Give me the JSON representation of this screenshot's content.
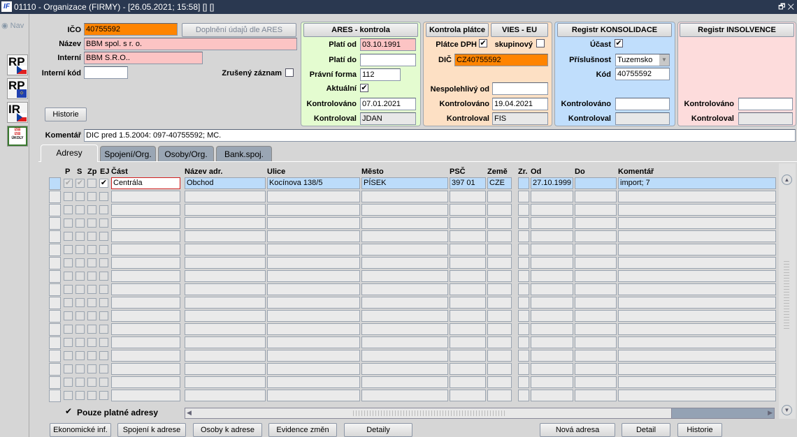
{
  "window": {
    "title": "01110 - Organizace (FIRMY) - [26.05.2021; 15:58]  [] []",
    "logo": "IF",
    "controls": "🗗 ✕"
  },
  "sidebar": {
    "nav": "Nav",
    "buttons": [
      {
        "label": "RP",
        "flag": "cz"
      },
      {
        "label": "RP",
        "flag": "eu"
      },
      {
        "label": "IR",
        "flag": "cz"
      },
      {
        "label": "ÚKOLY",
        "icon": "checklist-icon"
      }
    ]
  },
  "form": {
    "ico_label": "IČO",
    "ico": "40755592",
    "ares_fill": "Doplnění údajů dle ARES",
    "nazev_label": "Název",
    "nazev": "BBM spol. s r. o.",
    "interni_label": "Interní",
    "interni": "BBM S.R.O..",
    "interni_kod_label": "Interní kód",
    "interni_kod": "",
    "zruseny_label": "Zrušený záznam",
    "zruseny": false,
    "historie": "Historie",
    "komentar_label": "Komentář",
    "komentar": "DIC pred 1.5.2004: 097-40755592; MC."
  },
  "ares": {
    "title": "ARES - kontrola",
    "plati_od_label": "Platí od",
    "plati_od": "03.10.1991",
    "plati_do_label": "Platí do",
    "plati_do": "",
    "pravni_forma_label": "Právní forma",
    "pravni_forma": "112",
    "aktualni_label": "Aktuální",
    "aktualni": true,
    "kontrolovano_label": "Kontrolováno",
    "kontrolovano": "07.01.2021",
    "kontroloval_label": "Kontroloval",
    "kontroloval": "JDAN"
  },
  "platce": {
    "title": "Kontrola plátce",
    "vies": "VIES - EU",
    "platce_dph_label": "Plátce DPH",
    "platce_dph": true,
    "skupinovy_label": "skupinový",
    "skupinovy": false,
    "dic_label": "DIČ",
    "dic": "CZ40755592",
    "nespolehlivy_label": "Nespolehlivý od",
    "nespolehlivy": "",
    "kontrolovano_label": "Kontrolováno",
    "kontrolovano": "19.04.2021",
    "kontroloval_label": "Kontroloval",
    "kontroloval": "FIS"
  },
  "konsolidace": {
    "title": "Registr KONSOLIDACE",
    "ucast_label": "Účast",
    "ucast": true,
    "prislusnost_label": "Příslušnost",
    "prislusnost": "Tuzemsko",
    "kod_label": "Kód",
    "kod": "40755592",
    "kontrolovano_label": "Kontrolováno",
    "kontrolovano": "",
    "kontroloval_label": "Kontroloval",
    "kontroloval": ""
  },
  "insolvence": {
    "title": "Registr INSOLVENCE",
    "kontrolovano_label": "Kontrolováno",
    "kontrolovano": "",
    "kontroloval_label": "Kontroloval",
    "kontroloval": ""
  },
  "tabs": [
    "Adresy",
    "Spojení/Org.",
    "Osoby/Org.",
    "Bank.spoj."
  ],
  "grid": {
    "headers": {
      "p": "P",
      "s": "S",
      "zp": "Zp",
      "ej": "EJ",
      "cast": "Část",
      "nazev": "Název adr.",
      "ulice": "Ulice",
      "mesto": "Město",
      "psc": "PSČ",
      "zeme": "Země",
      "zr": "Zr.",
      "od": "Od",
      "do": "Do",
      "komentar": "Komentář"
    },
    "rows": [
      {
        "p": true,
        "s": true,
        "zp": false,
        "ej": true,
        "cast": "Centrála",
        "nazev": "Obchod",
        "ulice": "Kocínova 138/5",
        "mesto": "PÍSEK",
        "psc": "397 01",
        "zeme": "CZE",
        "zr": "",
        "od": "27.10.1999",
        "do": "",
        "komentar": "import; 7"
      }
    ],
    "visible_rows": 17
  },
  "pouze_platne_label": "Pouze platné adresy",
  "pouze_platne": true,
  "bottom_buttons": {
    "ekonomicke": "Ekonomické inf.",
    "spojeni": "Spojení k adrese",
    "osoby": "Osoby k adrese",
    "evidence": "Evidence změn",
    "detaily": "Detaily",
    "nova": "Nová adresa",
    "detail": "Detail",
    "historie": "Historie"
  }
}
